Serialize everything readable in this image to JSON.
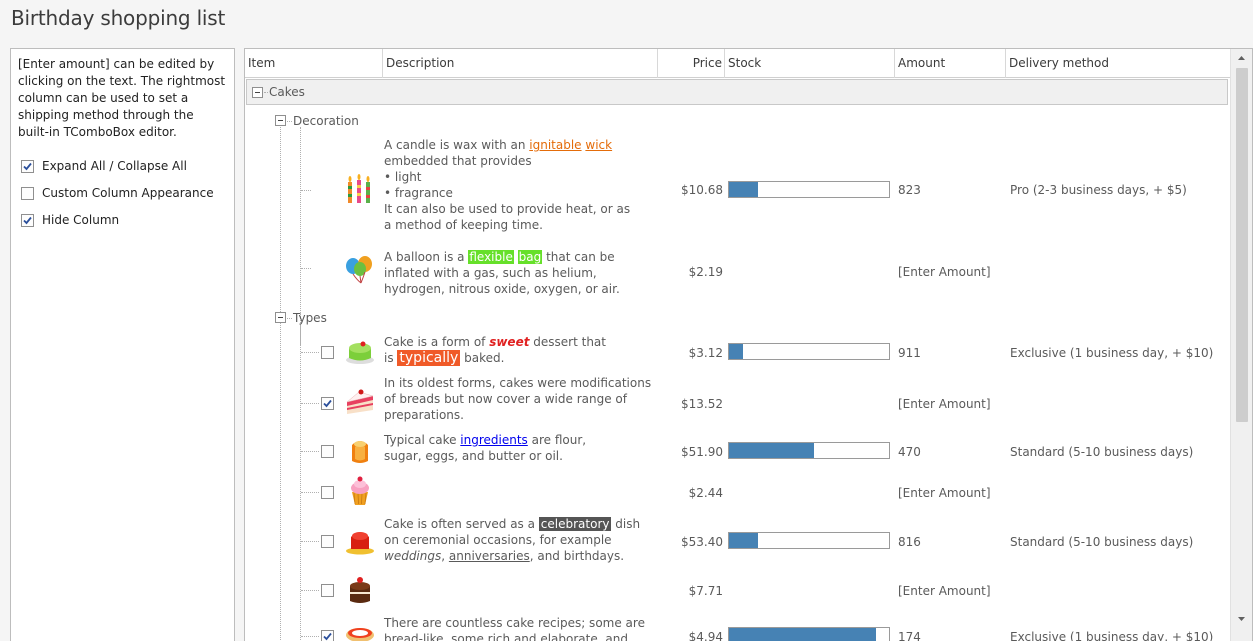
{
  "title": "Birthday shopping list",
  "side_panel": {
    "description": "[Enter amount] can be edited by clicking on the text. The rightmost column can be used to set a shipping method through the built-in TComboBox editor.",
    "options": [
      {
        "label": "Expand All / Collapse All",
        "checked": true
      },
      {
        "label": "Custom Column Appearance",
        "checked": false
      },
      {
        "label": "Hide Column",
        "checked": true
      }
    ]
  },
  "grid": {
    "columns": [
      "Item",
      "Description",
      "Price",
      "Stock",
      "Amount",
      "Delivery method"
    ],
    "group": "Cakes",
    "subgroups": [
      "Decoration",
      "Types"
    ],
    "rows": [
      {
        "icon": "candles-icon",
        "checkbox": null,
        "price": "$10.68",
        "stock": 0.18,
        "amount": "823",
        "delivery": "Pro (2-3 business days, + $5)",
        "desc": {
          "a": "A candle is wax with an ",
          "link1": "ignitable",
          "link2": "wick",
          "b": "embedded that provides",
          "bullet1": "light",
          "bullet2": "fragrance",
          "c": "It can also be used to provide heat, or as",
          "d": "a method of keeping time."
        }
      },
      {
        "icon": "balloons-icon",
        "checkbox": null,
        "price": "$2.19",
        "stock": null,
        "amount": "[Enter Amount]",
        "delivery": "",
        "desc": {
          "a": "A balloon is a ",
          "hl1": "flexible",
          "hl2": "bag",
          "b": " that can be",
          "c": "inflated with a gas, such as helium,",
          "d": "hydrogen, nitrous oxide, oxygen, or air."
        }
      },
      {
        "icon": "green-cake-icon",
        "checkbox": false,
        "price": "$3.12",
        "stock": 0.09,
        "amount": "911",
        "delivery": "Exclusive (1 business day, + $10)",
        "desc": {
          "a": "Cake is a form of ",
          "em": "sweet",
          "b": " dessert that",
          "c": "is ",
          "hl": "typically",
          "d": " baked."
        }
      },
      {
        "icon": "cake-slice-icon",
        "checkbox": true,
        "price": "$13.52",
        "stock": null,
        "amount": "[Enter Amount]",
        "delivery": "",
        "desc": {
          "a": "In its oldest forms, cakes were modifications",
          "b": "of breads but now cover a wide range of",
          "c": "preparations."
        }
      },
      {
        "icon": "orange-cake-icon",
        "checkbox": false,
        "price": "$51.90",
        "stock": 0.53,
        "amount": "470",
        "delivery": "Standard (5-10 business days)",
        "desc": {
          "a": "Typical cake ",
          "link": "ingredients",
          "b": " are flour,",
          "c": "sugar, eggs, and butter or oil."
        }
      },
      {
        "icon": "cupcake-icon",
        "checkbox": false,
        "price": "$2.44",
        "stock": null,
        "amount": "[Enter Amount]",
        "delivery": "",
        "desc": null
      },
      {
        "icon": "red-dessert-icon",
        "checkbox": false,
        "price": "$53.40",
        "stock": 0.18,
        "amount": "816",
        "delivery": "Standard (5-10 business days)",
        "desc": {
          "a": "Cake is often served as a ",
          "hl": "celebratory",
          "b": " dish",
          "c": "on ceremonial occasions, for example",
          "i1": "weddings",
          "sep": ", ",
          "u1": "anniversaries",
          "d": ", and birthdays."
        }
      },
      {
        "icon": "chocolate-cake-icon",
        "checkbox": false,
        "price": "$7.71",
        "stock": null,
        "amount": "[Enter Amount]",
        "delivery": "",
        "desc": null
      },
      {
        "icon": "pie-icon",
        "checkbox": true,
        "price": "$4.94",
        "stock": 0.92,
        "amount": "174",
        "delivery": "Exclusive (1 business day, + $10)",
        "desc": {
          "a": "There are countless cake recipes; some are",
          "b": "bread-like, some rich and elaborate, and"
        }
      }
    ]
  },
  "colors": {
    "accent": "#4682b4",
    "orange_link": "#e46c0a",
    "green_highlight": "#66e02a",
    "red_highlight": "#f05a28"
  }
}
